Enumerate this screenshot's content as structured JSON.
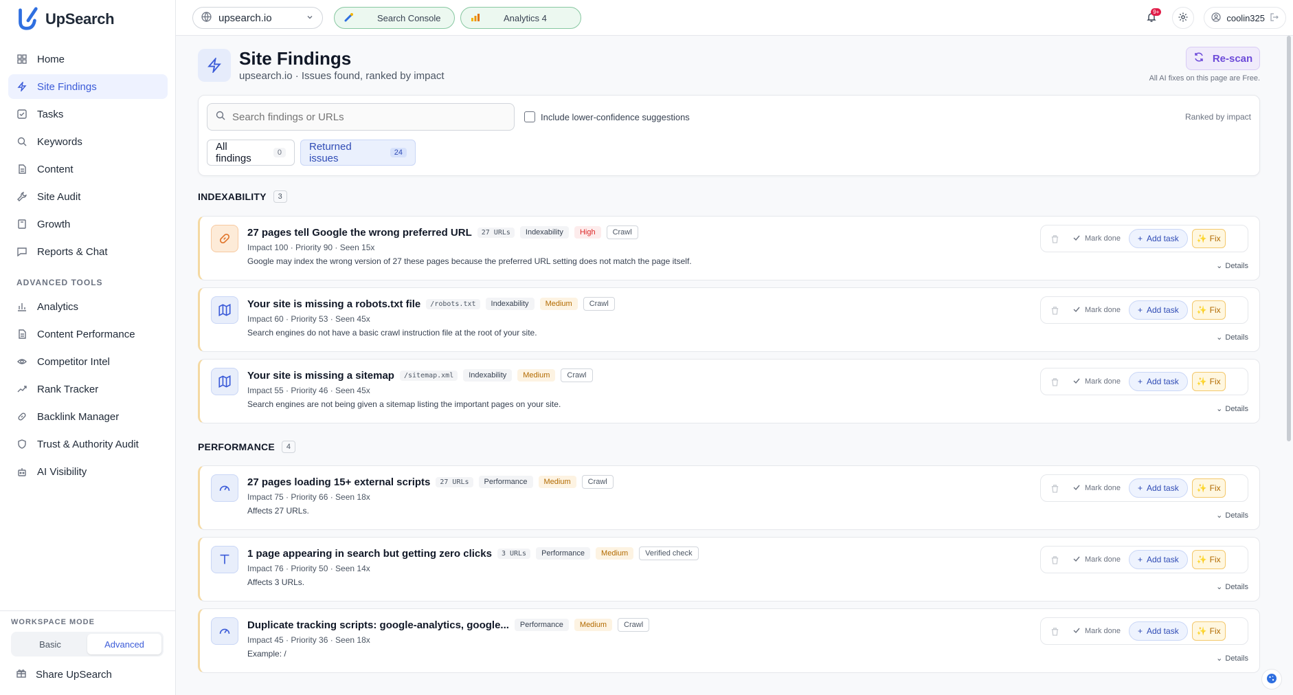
{
  "app": {
    "name": "UpSearch"
  },
  "sidebar": {
    "items": [
      {
        "label": "Home",
        "icon": "grid-icon"
      },
      {
        "label": "Site Findings",
        "icon": "bolt-icon",
        "active": true
      },
      {
        "label": "Tasks",
        "icon": "checklist-icon"
      },
      {
        "label": "Keywords",
        "icon": "search-icon"
      },
      {
        "label": "Content",
        "icon": "document-icon"
      },
      {
        "label": "Site Audit",
        "icon": "wrench-icon"
      },
      {
        "label": "Growth",
        "icon": "book-icon"
      },
      {
        "label": "Reports & Chat",
        "icon": "chat-icon"
      }
    ],
    "advanced_label": "ADVANCED TOOLS",
    "advanced_items": [
      {
        "label": "Analytics",
        "icon": "bar-chart-icon"
      },
      {
        "label": "Content Performance",
        "icon": "document-icon"
      },
      {
        "label": "Competitor Intel",
        "icon": "eye-icon"
      },
      {
        "label": "Rank Tracker",
        "icon": "trend-icon"
      },
      {
        "label": "Backlink Manager",
        "icon": "link-icon"
      },
      {
        "label": "Trust & Authority Audit",
        "icon": "shield-icon"
      },
      {
        "label": "AI Visibility",
        "icon": "robot-icon"
      }
    ],
    "workspace": {
      "label": "WORKSPACE MODE",
      "basic": "Basic",
      "advanced": "Advanced",
      "selected": "Advanced"
    },
    "share_label": "Share UpSearch"
  },
  "topbar": {
    "domain": "upsearch.io",
    "search_console": "Search Console",
    "analytics": "Analytics 4",
    "notif_badge": "9+",
    "username": "coolin325"
  },
  "page": {
    "title": "Site Findings",
    "subtitle": "upsearch.io · Issues found, ranked by impact",
    "rescan_label": "Re-scan",
    "ai_note": "All AI fixes on this page are Free."
  },
  "filters": {
    "search_placeholder": "Search findings or URLs",
    "checkbox_label": "Include lower-confidence suggestions",
    "ranked_label": "Ranked by impact",
    "tabs": [
      {
        "label": "All findings",
        "count": "0"
      },
      {
        "label": "Returned issues",
        "count": "24",
        "active": true
      }
    ]
  },
  "actions": {
    "mark_done": "Mark done",
    "add_task": "Add task",
    "fix": "Fix",
    "details": "Details"
  },
  "sections": [
    {
      "name": "INDEXABILITY",
      "count": "3",
      "findings": [
        {
          "title": "27 pages tell Google the wrong preferred URL",
          "mono_tag": "27 URLs",
          "category": "Indexability",
          "severity": "High",
          "source": "Crawl",
          "meta": "Impact 100 · Priority 90 · Seen 15x",
          "desc": "Google may index the wrong version of 27 these pages because the preferred URL setting does not match the page itself.",
          "icon": "link-icon"
        },
        {
          "title": "Your site is missing a robots.txt file",
          "mono_tag": "/robots.txt",
          "category": "Indexability",
          "severity": "Medium",
          "source": "Crawl",
          "meta": "Impact 60 · Priority 53 · Seen 45x",
          "desc": "Search engines do not have a basic crawl instruction file at the root of your site.",
          "icon": "map-icon"
        },
        {
          "title": "Your site is missing a sitemap",
          "mono_tag": "/sitemap.xml",
          "category": "Indexability",
          "severity": "Medium",
          "source": "Crawl",
          "meta": "Impact 55 · Priority 46 · Seen 45x",
          "desc": "Search engines are not being given a sitemap listing the important pages on your site.",
          "icon": "map-icon"
        }
      ]
    },
    {
      "name": "PERFORMANCE",
      "count": "4",
      "findings": [
        {
          "title": "27 pages loading 15+ external scripts",
          "mono_tag": "27 URLs",
          "category": "Performance",
          "severity": "Medium",
          "source": "Crawl",
          "meta": "Impact 75 · Priority 66 · Seen 18x",
          "desc": "Affects 27 URLs.",
          "icon": "gauge-icon"
        },
        {
          "title": "1 page appearing in search but getting zero clicks",
          "mono_tag": "3 URLs",
          "category": "Performance",
          "severity": "Medium",
          "source": "Verified check",
          "meta": "Impact 76 · Priority 50 · Seen 14x",
          "desc": "Affects 3 URLs.",
          "icon": "text-icon"
        },
        {
          "title": "Duplicate tracking scripts: google-analytics, google...",
          "mono_tag": "",
          "category": "Performance",
          "severity": "Medium",
          "source": "Crawl",
          "meta": "Impact 45 · Priority 36 · Seen 18x",
          "desc": "Example: /",
          "icon": "gauge-icon"
        }
      ]
    }
  ]
}
